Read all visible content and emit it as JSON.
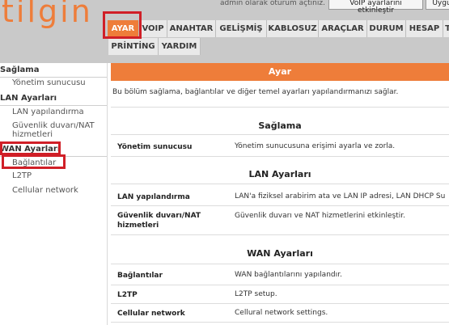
{
  "header": {
    "logo": "tilgin",
    "admin_text": "admin olarak oturum açtınız.",
    "voip_button": "VoIP ayarlarını etkinleştir",
    "apply_button": "Uygu"
  },
  "nav": {
    "row1": [
      "AYAR",
      "VOIP",
      "ANAHTAR",
      "GELİŞMİŞ",
      "KABLOSUZ",
      "ARAÇLAR",
      "DURUM",
      "HESAP",
      "T"
    ],
    "row2": [
      "PRİNTİNG",
      "YARDIM"
    ],
    "active": "AYAR"
  },
  "sidebar": {
    "sections": [
      {
        "title": "Sağlama",
        "items": [
          "Yönetim sunucusu"
        ]
      },
      {
        "title": "LAN Ayarları",
        "items": [
          "LAN yapılandırma",
          "Güvenlik duvarı/NAT hizmetleri"
        ]
      },
      {
        "title": "WAN Ayarları",
        "items": [
          "Bağlantılar",
          "L2TP",
          "Cellular network"
        ]
      }
    ]
  },
  "content": {
    "title": "Ayar",
    "description": "Bu bölüm sağlama, bağlantılar ve diğer temel ayarları yapılandırmanızı sağlar.",
    "sections": [
      {
        "heading": "Sağlama",
        "rows": [
          {
            "label": "Yönetim sunucusu",
            "desc": "Yönetim sunucusuna erişimi ayarla ve zorla."
          }
        ]
      },
      {
        "heading": "LAN Ayarları",
        "rows": [
          {
            "label": "LAN yapılandırma",
            "desc": "LAN'a fiziksel arabirim ata ve LAN IP adresi, LAN DHCP Su"
          },
          {
            "label": "Güvenlik duvarı/NAT hizmetleri",
            "desc": "Güvenlik duvarı ve NAT hizmetlerini etkinleştir."
          }
        ]
      },
      {
        "heading": "WAN Ayarları",
        "rows": [
          {
            "label": "Bağlantılar",
            "desc": "WAN bağlantılarını yapılandır."
          },
          {
            "label": "L2TP",
            "desc": "L2TP setup."
          },
          {
            "label": "Cellular network",
            "desc": "Cellural network settings."
          }
        ]
      }
    ]
  },
  "colors": {
    "accent": "#ee7d3a",
    "highlight": "#d01f27",
    "header_bg": "#c9c9c9",
    "tab_bg": "#e9e9e9"
  }
}
